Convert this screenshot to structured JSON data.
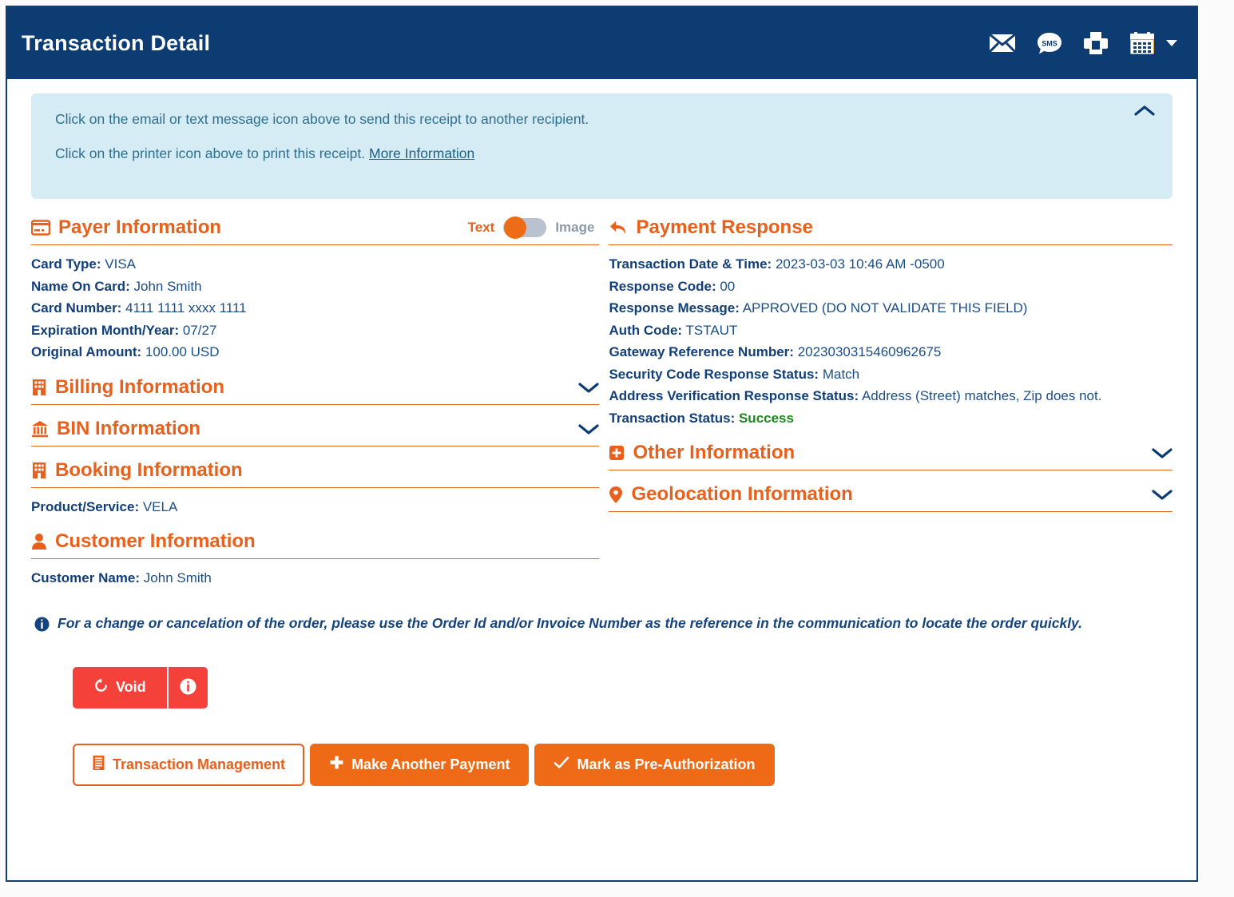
{
  "header": {
    "title": "Transaction Detail",
    "icons": [
      {
        "name": "email-icon",
        "label": "Email Receipt"
      },
      {
        "name": "sms-icon",
        "label": "SMS"
      },
      {
        "name": "print-icon",
        "label": "Print"
      },
      {
        "name": "calendar-icon",
        "label": "Calendar"
      }
    ]
  },
  "banner": {
    "line1": "Click on the email or text message icon above to send this receipt to another recipient.",
    "line2_prefix": "Click on the printer icon above to print this receipt.",
    "more_link": "More Information",
    "collapse_icon": "chevron-up-icon"
  },
  "payer": {
    "title": "Payer Information",
    "icon": "credit-card-icon",
    "toggle": {
      "left_label": "Text",
      "right_label": "Image",
      "selected": "Text"
    },
    "fields": [
      {
        "label": "Card Type:",
        "value": "VISA"
      },
      {
        "label": "Name On Card:",
        "value": "John Smith"
      },
      {
        "label": "Card Number:",
        "value": "4111 1111 xxxx 1111"
      },
      {
        "label": "Expiration Month/Year:",
        "value": "07/27"
      },
      {
        "label": "Original Amount:",
        "value": "100.00 USD"
      }
    ]
  },
  "billing": {
    "title": "Billing Information",
    "icon": "building-icon",
    "chevron": "chevron-down-icon"
  },
  "bin": {
    "title": "BIN Information",
    "icon": "bank-icon",
    "chevron": "chevron-down-icon"
  },
  "booking": {
    "title": "Booking Information",
    "icon": "building-icon",
    "fields": [
      {
        "label": "Product/Service:",
        "value": "VELA"
      }
    ]
  },
  "customer": {
    "title": "Customer Information",
    "icon": "user-icon",
    "fields": [
      {
        "label": "Customer Name:",
        "value": "John Smith"
      }
    ]
  },
  "payment_response": {
    "title": "Payment Response",
    "icon": "reply-arrow-icon",
    "fields": [
      {
        "label": "Transaction Date & Time:",
        "value": "2023-03-03 10:46 AM -0500"
      },
      {
        "label": "Response Code:",
        "value": "00"
      },
      {
        "label": "Response Message:",
        "value": "APPROVED (DO NOT VALIDATE THIS FIELD)"
      },
      {
        "label": "Auth Code:",
        "value": "TSTAUT"
      },
      {
        "label": "Gateway Reference Number:",
        "value": "2023030315460962675"
      },
      {
        "label": "Security Code Response Status:",
        "value": "Match"
      },
      {
        "label": "Address Verification Response Status:",
        "value": "Address (Street) matches, Zip does not."
      },
      {
        "label": "Transaction Status:",
        "value": "Success",
        "status": "success"
      }
    ]
  },
  "other_info": {
    "title": "Other Information",
    "icon": "plus-square-icon",
    "chevron": "chevron-down-icon"
  },
  "geolocation": {
    "title": "Geolocation Information",
    "icon": "map-pin-icon",
    "chevron": "chevron-down-icon"
  },
  "note": {
    "icon": "info-circle-icon",
    "text": "For a change or cancelation of the order, please use the Order Id and/or Invoice Number as the reference in the communication to locate the order quickly."
  },
  "actions": {
    "void_label": "Void",
    "void_icon": "undo-icon",
    "void_info_icon": "info-circle-icon",
    "transaction_management_label": "Transaction Management",
    "transaction_management_icon": "receipt-icon",
    "make_another_payment_label": "Make Another Payment",
    "make_another_payment_icon": "plus-icon",
    "mark_preauth_label": "Mark as Pre-Authorization",
    "mark_preauth_icon": "check-icon"
  },
  "colors": {
    "navy": "#0d3c72",
    "orange": "#e8601c",
    "orange_solid": "#ef6a16",
    "red": "#f4413a",
    "banner_bg": "#d6ecf5",
    "success_green": "#1a8a1a",
    "text_blue": "#16457c"
  }
}
